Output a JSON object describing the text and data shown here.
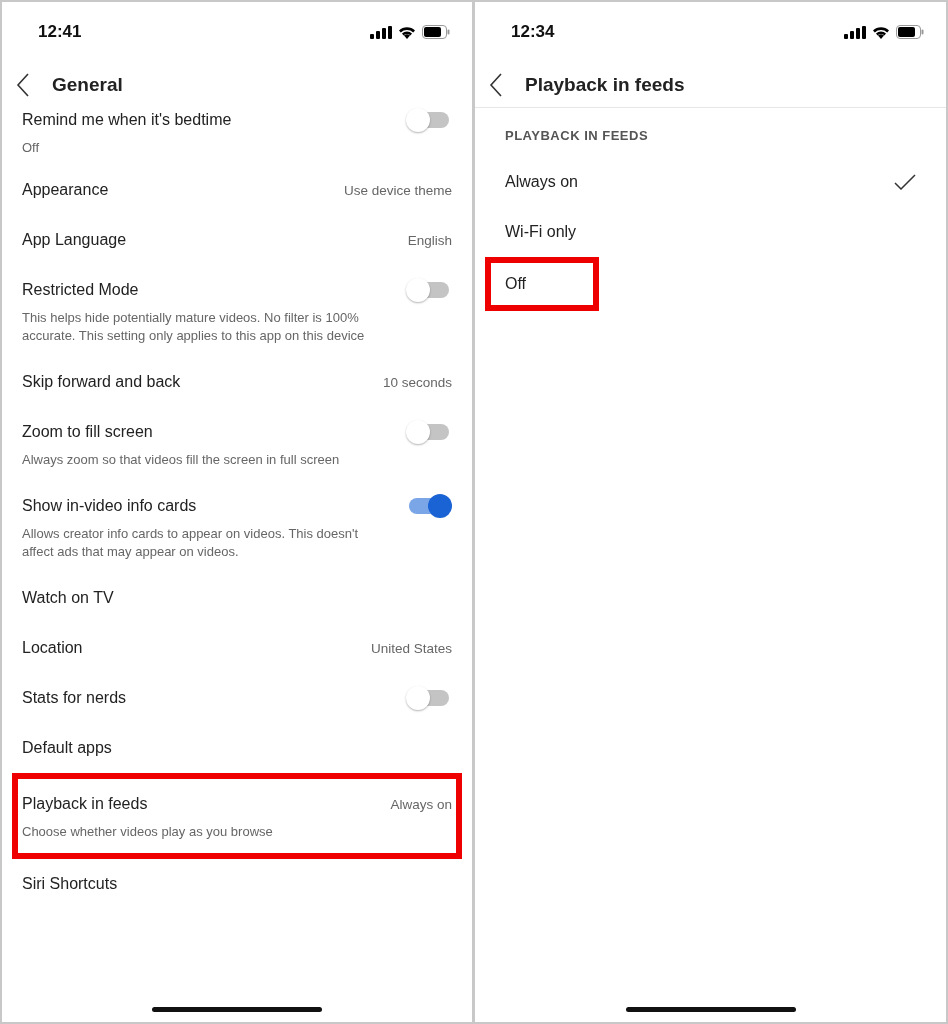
{
  "panels": [
    {
      "status_bar": {
        "time": "12:41"
      },
      "header": {
        "title": "General"
      },
      "rows": [
        {
          "kind": "toggle",
          "title": "Remind me when it's bedtime",
          "on": false,
          "description": "Off",
          "highlighted": false
        },
        {
          "kind": "value",
          "title": "Appearance",
          "value": "Use device theme",
          "highlighted": false
        },
        {
          "kind": "value",
          "title": "App Language",
          "value": "English",
          "highlighted": false
        },
        {
          "kind": "toggle",
          "title": "Restricted Mode",
          "on": false,
          "description": "This helps hide potentially mature videos. No filter is 100% accurate. This setting only applies to this app on this device",
          "highlighted": false
        },
        {
          "kind": "value",
          "title": "Skip forward and back",
          "value": "10 seconds",
          "highlighted": false
        },
        {
          "kind": "toggle",
          "title": "Zoom to fill screen",
          "on": false,
          "description": "Always zoom so that videos fill the screen in full screen",
          "highlighted": false
        },
        {
          "kind": "toggle",
          "title": "Show in-video info cards",
          "on": true,
          "description": "Allows creator info cards to appear on videos. This doesn't affect ads that may appear on videos.",
          "highlighted": false
        },
        {
          "kind": "value",
          "title": "Watch on TV",
          "highlighted": false
        },
        {
          "kind": "value",
          "title": "Location",
          "value": "United States",
          "highlighted": false
        },
        {
          "kind": "toggle",
          "title": "Stats for nerds",
          "on": false,
          "highlighted": false
        },
        {
          "kind": "value",
          "title": "Default apps",
          "highlighted": false
        },
        {
          "kind": "value",
          "title": "Playback in feeds",
          "value": "Always on",
          "description": "Choose whether videos play as you browse",
          "highlighted": true
        },
        {
          "kind": "value",
          "title": "Siri Shortcuts",
          "highlighted": false
        }
      ]
    },
    {
      "status_bar": {
        "time": "12:34"
      },
      "header": {
        "title": "Playback in feeds"
      },
      "section_title": "PLAYBACK IN FEEDS",
      "options": [
        {
          "label": "Always on",
          "selected": true,
          "highlighted": false
        },
        {
          "label": "Wi-Fi only",
          "selected": false,
          "highlighted": false
        },
        {
          "label": "Off",
          "selected": false,
          "highlighted": true
        }
      ]
    }
  ]
}
